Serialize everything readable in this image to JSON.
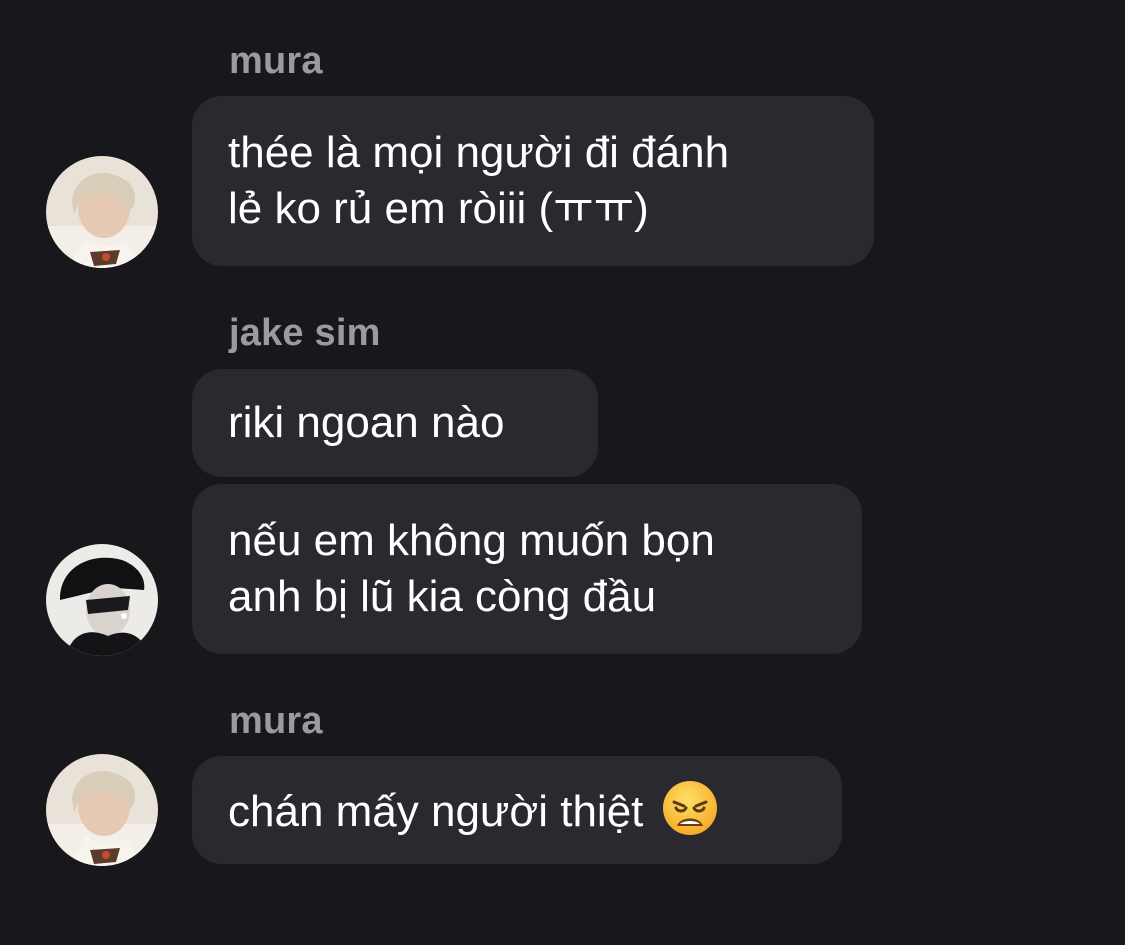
{
  "messages": [
    {
      "sender": "mura",
      "bubbles": [
        "thée là mọi người đi đánh\nlẻ ko rủ em ròiii (ㅠㅠ)"
      ],
      "avatar": "blonde-boy-avatar"
    },
    {
      "sender": "jake sim",
      "bubbles": [
        "riki ngoan nào",
        "nếu em không muốn bọn\nanh bị lũ kia còng đầu"
      ],
      "avatar": "black-cap-boy-avatar"
    },
    {
      "sender": "mura",
      "bubbles": [
        "chán mấy người thiệt"
      ],
      "emoji": "weary-face-icon",
      "avatar": "blonde-boy-avatar"
    }
  ],
  "colors": {
    "background": "#18171c",
    "bubble": "#2a292f",
    "sender_name": "#9b9aa2",
    "message_text": "#ffffff"
  }
}
